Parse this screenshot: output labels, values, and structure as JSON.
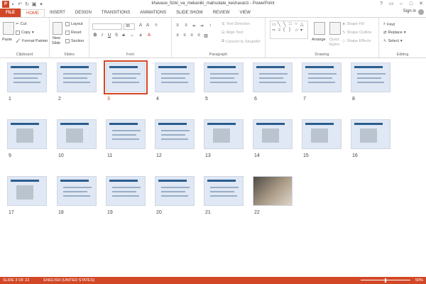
{
  "window": {
    "title": "khavase_fiziki_va_mekaniki_mahsolate_keshavarzi - PowerPoint",
    "sign_in": "Sign in"
  },
  "tabs": [
    "FILE",
    "HOME",
    "INSERT",
    "DESIGN",
    "TRANSITIONS",
    "ANIMATIONS",
    "SLIDE SHOW",
    "REVIEW",
    "VIEW"
  ],
  "ribbon": {
    "clipboard": {
      "label": "Clipboard",
      "paste": "Paste",
      "cut": "Cut",
      "copy": "Copy",
      "format_painter": "Format Painter"
    },
    "slides": {
      "label": "Slides",
      "new_slide": "New",
      "new_slide2": "Slide",
      "layout": "Layout",
      "reset": "Reset",
      "section": "Section"
    },
    "font": {
      "label": "Font",
      "size": "36"
    },
    "paragraph": {
      "label": "Paragraph",
      "text_direction": "Text Direction",
      "align_text": "Align Text",
      "convert_smartart": "Convert to SmartArt"
    },
    "drawing": {
      "label": "Drawing",
      "arrange": "Arrange",
      "quick_styles": "Quick",
      "quick_styles2": "Styles",
      "shape_fill": "Shape Fill",
      "shape_outline": "Shape Outline",
      "shape_effects": "Shape Effects"
    },
    "editing": {
      "label": "Editing",
      "find": "Find",
      "replace": "Replace",
      "select": "Select"
    }
  },
  "slides": [
    {
      "num": "1"
    },
    {
      "num": "2"
    },
    {
      "num": "3"
    },
    {
      "num": "4"
    },
    {
      "num": "5"
    },
    {
      "num": "6"
    },
    {
      "num": "7"
    },
    {
      "num": "8"
    },
    {
      "num": "9"
    },
    {
      "num": "10"
    },
    {
      "num": "11"
    },
    {
      "num": "12"
    },
    {
      "num": "13"
    },
    {
      "num": "14"
    },
    {
      "num": "15"
    },
    {
      "num": "16"
    },
    {
      "num": "17"
    },
    {
      "num": "18"
    },
    {
      "num": "19"
    },
    {
      "num": "20"
    },
    {
      "num": "21"
    },
    {
      "num": "22"
    }
  ],
  "selected_slide": 3,
  "status": {
    "slide": "SLIDE 3 OF 22",
    "language": "ENGLISH (UNITED STATES)",
    "zoom": "50%"
  },
  "colors": {
    "accent": "#d24726"
  }
}
